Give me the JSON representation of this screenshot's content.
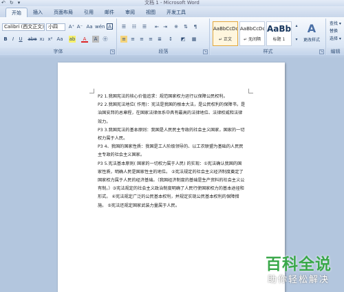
{
  "window": {
    "title": "文档 1 - Microsoft Word",
    "qat": [
      "↶",
      "↻",
      "▾"
    ]
  },
  "tabs": [
    "开始",
    "插入",
    "页面布局",
    "引用",
    "邮件",
    "审阅",
    "视图",
    "开发工具"
  ],
  "ribbon": {
    "font": {
      "font_name": "Calibri (西文正文)",
      "font_size": "小四",
      "grow": "A⁺",
      "shrink": "A⁻",
      "clear": "Aa",
      "phonetic": "wén",
      "border": "A",
      "bold": "B",
      "italic": "I",
      "underline": "U",
      "strike": "abe",
      "subscript": "x₂",
      "superscript": "x²",
      "change_case": "Aa",
      "highlight": "ab",
      "font_color": "A",
      "char_shading": "A",
      "circled": "㊉",
      "group_label": "字体"
    },
    "paragraph": {
      "group_label": "段落"
    },
    "styles": {
      "tiles": [
        {
          "sample": "AaBbCcDc",
          "name": "↵ 正文"
        },
        {
          "sample": "AaBbCcDc",
          "name": "↵ 无间隔"
        },
        {
          "sample": "AaBb",
          "name": "标题 1"
        }
      ],
      "change_style": "更改样式",
      "group_label": "样式"
    },
    "editing": {
      "items": [
        "查找 ▾",
        "替换",
        "选择 ▾"
      ],
      "group_label": "编辑"
    }
  },
  "document": {
    "paragraphs": [
      "P2 1.我国宪法的核心价值追求：规范国家权力运行以保障公民权利。",
      "P2 2.我国宪法地位( 作用)：宪法是我国的根本大法，是公民权利的保障书，是治国安邦的总章程，在国家法律体系中具有最高的法律地位、法律权威和法律效力。",
      "P3 3.我国宪法的基本原则：我国是人民民主专政的社会主义国家，国家的一切权力属于人民。",
      "P3 4、我国的国家性质：我国是工人阶级领导的、以工农联盟为基础的人民民主专政的社会主义国家。",
      "P3 5.宪法基本原则( 国家的一切权力属于人民) 的实现：①宪法确认我国的国家性质，明确人民是国家性主的地位。 ②宪法规定的社会主义经济制度奠定了国家权力属于人民的经济基础。（我国经济制度的基础是生产资料的社会主义公有制。）③宪法规定的社会主义政治制度明确了人民行使国家权力的基本途径和形式。 ④宪法规定广泛的公民基本权利，并规定实现公民基本权利的保障措施。 ⑤宪法还规定国家武装力量属于人民。"
    ]
  },
  "watermark": {
    "main": "百科全说",
    "sub": "助你轻松解决"
  }
}
